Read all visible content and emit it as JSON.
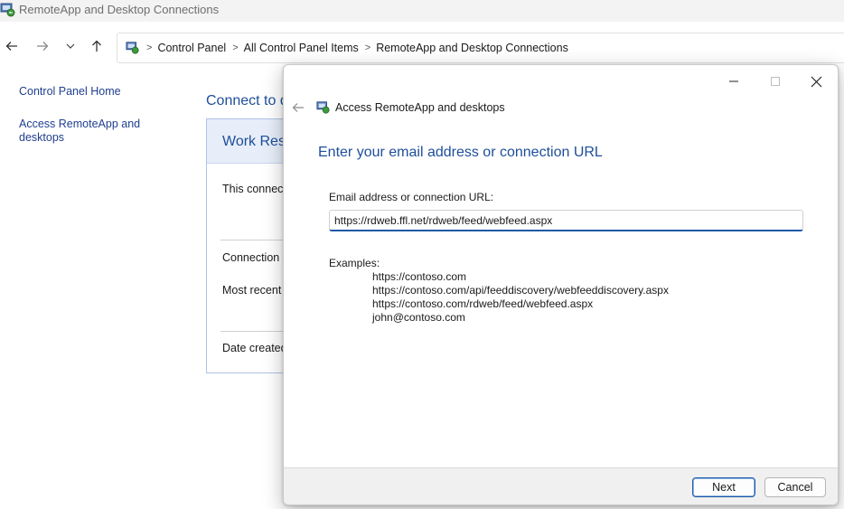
{
  "window": {
    "title": "RemoteApp and Desktop Connections",
    "icon": "remoteapp-icon"
  },
  "address_bar": {
    "breadcrumbs": [
      "Control Panel",
      "All Control Panel Items",
      "RemoteApp and Desktop Connections"
    ],
    "icons": [
      "back-arrow-icon",
      "forward-arrow-icon",
      "chevron-down-icon",
      "up-arrow-icon"
    ]
  },
  "sidebar": {
    "items": [
      {
        "label": "Control Panel Home"
      },
      {
        "label": "Access RemoteApp and desktops"
      }
    ]
  },
  "main": {
    "heading": "Connect to d",
    "panel": {
      "title": "Work Reso",
      "description": "This connect",
      "connection_status": "Connection s",
      "most_recent": "Most recent",
      "date_created": "Date created:"
    }
  },
  "dialog": {
    "title": "Access RemoteApp and desktops",
    "heading": "Enter your email address or connection URL",
    "field_label": "Email address or connection URL:",
    "field_value": "https://rdweb.ffl.net/rdweb/feed/webfeed.aspx",
    "examples_label": "Examples:",
    "examples": [
      "https://contoso.com",
      "https://contoso.com/api/feeddiscovery/webfeeddiscovery.aspx",
      "https://contoso.com/rdweb/feed/webfeed.aspx",
      "john@contoso.com"
    ],
    "buttons": {
      "next": "Next",
      "cancel": "Cancel"
    }
  },
  "colors": {
    "accent": "#1e5aa8",
    "heading_blue": "#1e4e9a",
    "link_blue": "#1f3f8f"
  }
}
